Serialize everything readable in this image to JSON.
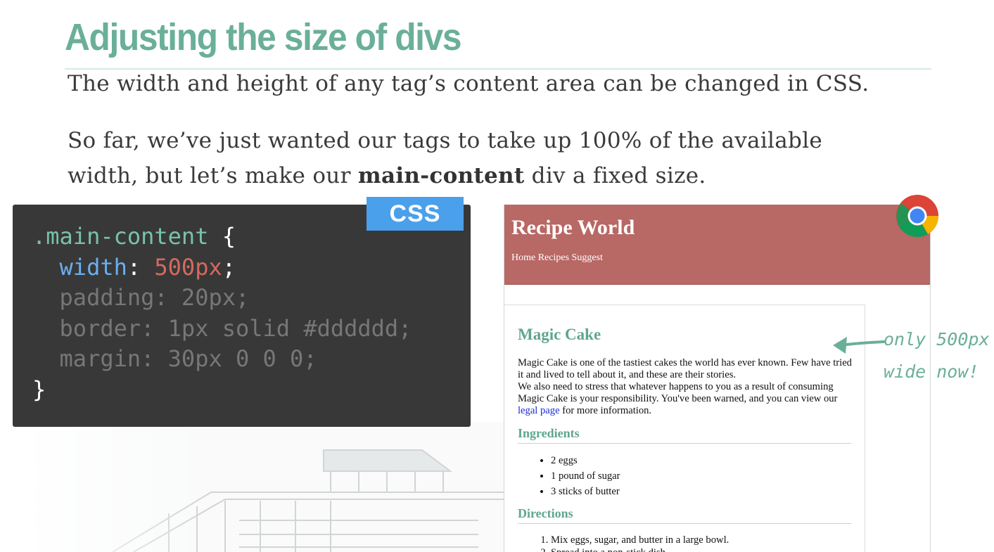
{
  "slide": {
    "title": "Adjusting the size of divs",
    "paragraph1": "The width and height of any tag’s content area can be changed in CSS.",
    "paragraph2_line1": "So far, we’ve just wanted our tags to take up 100% of the available",
    "paragraph2_line2_pre": "width, but let’s make our ",
    "paragraph2_line2_bold": "main-content",
    "paragraph2_line2_post": " div a fixed size."
  },
  "code_panel": {
    "tag": "CSS",
    "selector": ".main-content",
    "open_brace": "{",
    "close_brace": "}",
    "width_prop": "width",
    "width_value": "500px",
    "dim_line1": "padding: 20px;",
    "dim_line2": "border: 1px solid #dddddd;",
    "dim_line3": "margin: 30px 0 0 0;"
  },
  "browser": {
    "site_title": "Recipe World",
    "nav": "Home Recipes Suggest",
    "heading": "Magic Cake",
    "story_text1": "Magic Cake is one of the tastiest cakes the world has ever known. Few have tried it and lived to tell about it, and these are their stories.",
    "story_text2": "We also need to stress that whatever happens to you as a result of consuming Magic Cake is your responsibility. You've been warned, and you can view our",
    "story_link": "legal page",
    "story_text3": " for more information.",
    "ingredients_heading": "Ingredients",
    "ingredients": [
      "2 eggs",
      "1 pound of sugar",
      "3 sticks of butter"
    ],
    "directions_heading": "Directions",
    "directions": [
      "Mix eggs, sugar, and butter in a large bowl.",
      "Spread into a non-stick dish."
    ]
  },
  "annotation": {
    "line1": "only 500px",
    "line2": "wide now!"
  },
  "colors": {
    "title_green": "#6aaf99",
    "css_badge": "#4aa0ea",
    "header_red": "#b86865",
    "code_bg": "#383838"
  },
  "icons": {
    "browser_logo": "chrome-logo-icon",
    "arrow": "arrow-left-icon"
  }
}
